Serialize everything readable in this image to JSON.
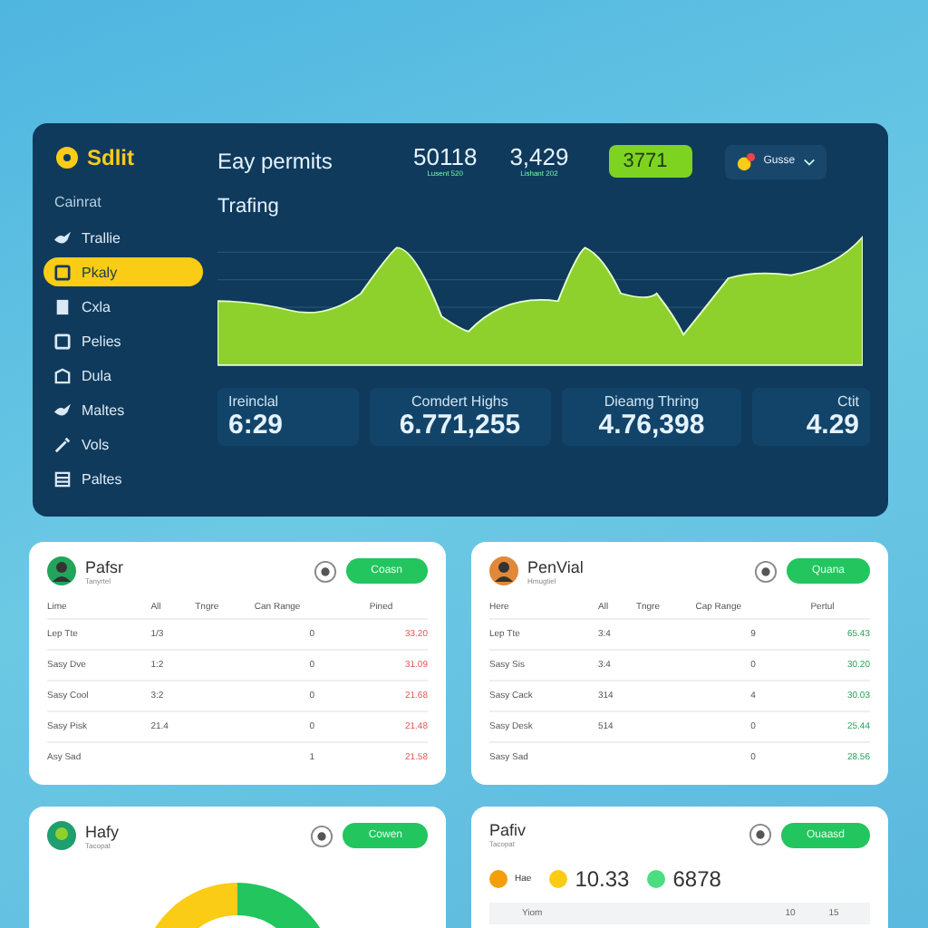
{
  "dashboard": {
    "logo": "Sdlit",
    "header_title": "Eay permits",
    "header_stats": [
      {
        "value": "50118",
        "caption": "Lusent 520"
      },
      {
        "value": "3,429",
        "caption": "Lishant 202"
      }
    ],
    "highlight_value": "3771",
    "user_menu": "Gusse",
    "chart_title": "Trafing",
    "sidebar": {
      "section": "Cainrat",
      "items": [
        {
          "label": "Trallie",
          "selected": false
        },
        {
          "label": "Pkaly",
          "selected": true
        },
        {
          "label": "Cxla",
          "selected": false
        },
        {
          "label": "Pelies",
          "selected": false
        },
        {
          "label": "Dula",
          "selected": false
        },
        {
          "label": "Maltes",
          "selected": false
        },
        {
          "label": "Vols",
          "selected": false
        },
        {
          "label": "Paltes",
          "selected": false
        }
      ]
    },
    "stats": [
      {
        "label": "Ireinclal",
        "value": "6:29"
      },
      {
        "label": "Comdert Highs",
        "value": "6.771,255"
      },
      {
        "label": "Dieamg Thring",
        "value": "4.76,398"
      },
      {
        "label": "Ctit",
        "value": "4.29"
      }
    ]
  },
  "tables": [
    {
      "title": "Pafsr",
      "subtitle": "Tanyrtel",
      "button": "Coasn",
      "kind": "loss",
      "columns": [
        "Lime",
        "All",
        "Tngre",
        "Can Range",
        "Pined"
      ],
      "rows": [
        [
          "Lep Tte",
          "1/3",
          "",
          "0",
          "33.20"
        ],
        [
          "Sasy Dve",
          "1:2",
          "",
          "0",
          "31.09"
        ],
        [
          "Sasy Cool",
          "3:2",
          "",
          "0",
          "21.68"
        ],
        [
          "Sasy Pisk",
          "21.4",
          "",
          "0",
          "21.48"
        ],
        [
          "Asy Sad",
          "",
          "",
          "1",
          "21.58"
        ]
      ]
    },
    {
      "title": "PenVial",
      "subtitle": "Hmugtiel",
      "button": "Quana",
      "kind": "gain",
      "columns": [
        "Here",
        "All",
        "Tngre",
        "Cap Range",
        "Pertul"
      ],
      "rows": [
        [
          "Lep Tte",
          "3:4",
          "",
          "9",
          "65.43"
        ],
        [
          "Sasy Sis",
          "3:4",
          "",
          "0",
          "30.20"
        ],
        [
          "Sasy Cack",
          "314",
          "",
          "4",
          "30.03"
        ],
        [
          "Sasy Desk",
          "514",
          "",
          "0",
          "25.44"
        ],
        [
          "Sasy Sad",
          "",
          "",
          "0",
          "28.56"
        ]
      ]
    }
  ],
  "bottom_cards": [
    {
      "kind": "donut",
      "title": "Hafy",
      "subtitle": "Tacopat",
      "button": "Cowen"
    },
    {
      "kind": "legend",
      "title": "Pafiv",
      "subtitle": "Tacopat",
      "button": "Ouaasd",
      "legend": [
        {
          "label": "Hae",
          "color": "#f59e0b"
        },
        {
          "label": "10.33",
          "color": "#facc15"
        },
        {
          "label": "6878",
          "color": "#4ade80"
        }
      ],
      "columns": [
        "Yiom",
        "10",
        "15"
      ]
    }
  ]
}
